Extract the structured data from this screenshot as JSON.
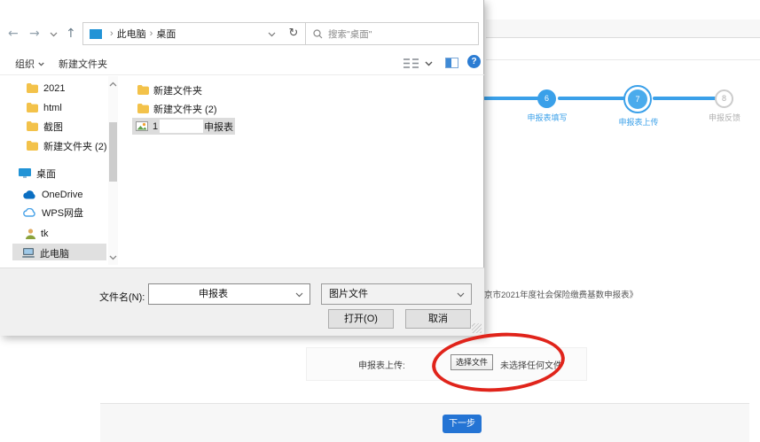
{
  "dialog": {
    "nav": {
      "breadcrumb": {
        "separator": "›",
        "root": "此电脑",
        "current": "桌面"
      },
      "search_text": "搜索\"桌面\"",
      "refresh_glyph": "↻",
      "back_glyph": "←",
      "forward_glyph": "→",
      "up_glyph": "↑"
    },
    "toolbar": {
      "organize_label": "组织",
      "new_folder_label": "新建文件夹"
    },
    "sidebar": {
      "items": [
        {
          "label": "2021"
        },
        {
          "label": "html"
        },
        {
          "label": "截图"
        },
        {
          "label": "新建文件夹 (2)"
        },
        {
          "label": "桌面"
        },
        {
          "label": "OneDrive"
        },
        {
          "label": "WPS网盘"
        },
        {
          "label": "tk"
        },
        {
          "label": "此电脑"
        }
      ]
    },
    "files": {
      "items": [
        {
          "label": "新建文件夹"
        },
        {
          "label": "新建文件夹 (2)"
        }
      ],
      "selected_file": {
        "prefix": "1",
        "suffix": "申报表"
      }
    },
    "footer": {
      "filename_label": "文件名(N):",
      "filename_value": "申报表",
      "filetype_value": "图片文件",
      "open_label": "打开(O)",
      "cancel_label": "取消"
    }
  },
  "page": {
    "steps": [
      {
        "number": "6",
        "label": "申报表填写",
        "state": "done"
      },
      {
        "number": "7",
        "label": "申报表上传",
        "state": "current"
      },
      {
        "number": "8",
        "label": "申报反馈",
        "state": "pending"
      }
    ],
    "partial_text": "京市2021年度社会保险缴费基数申报表》",
    "upload": {
      "label": "申报表上传:",
      "choose_button": "选择文件",
      "status": "未选择任何文件"
    },
    "next_button": "下一步"
  },
  "colors": {
    "accent_blue": "#3aa0e9",
    "next_button_blue": "#2474d4",
    "annotation_red": "#e0241b"
  }
}
